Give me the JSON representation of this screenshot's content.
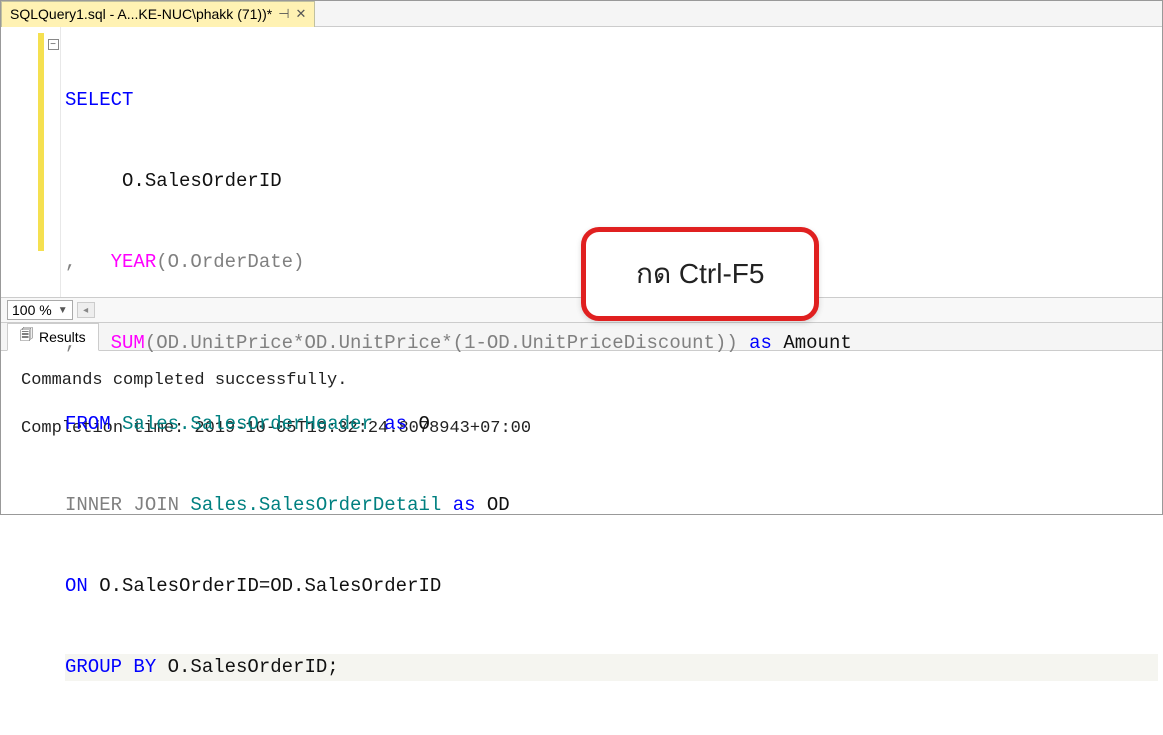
{
  "tab": {
    "title": "SQLQuery1.sql - A...KE-NUC\\phakk (71))*"
  },
  "code": {
    "l1": {
      "select": "SELECT"
    },
    "l2": {
      "indent": "     ",
      "col": "O.SalesOrderID"
    },
    "l3": {
      "comma": ",   ",
      "fn": "YEAR",
      "args": "(O.OrderDate)"
    },
    "l4": {
      "comma": ",   ",
      "fn": "SUM",
      "args": "(OD.UnitPrice*OD.UnitPrice*(1-OD.UnitPriceDiscount)) ",
      "as": "as",
      "alias": " Amount"
    },
    "l5": {
      "from": "FROM",
      "tbl": " Sales.SalesOrderHeader ",
      "as": "as",
      "alias": " O"
    },
    "l6": {
      "join": "INNER JOIN",
      "tbl": " Sales.SalesOrderDetail ",
      "as": "as",
      "alias": " OD"
    },
    "l7": {
      "on": "ON",
      "cond": " O.SalesOrderID=OD.SalesOrderID"
    },
    "l8": {
      "group": "GROUP BY",
      "col": " O.SalesOrderID;"
    }
  },
  "callout": {
    "text": "กด Ctrl-F5"
  },
  "zoom": {
    "value": "100 %"
  },
  "results": {
    "tab_label": "Results",
    "msg1": "Commands completed successfully.",
    "msg2": "Completion time: 2019-10-05T19:32:24.8078943+07:00"
  }
}
